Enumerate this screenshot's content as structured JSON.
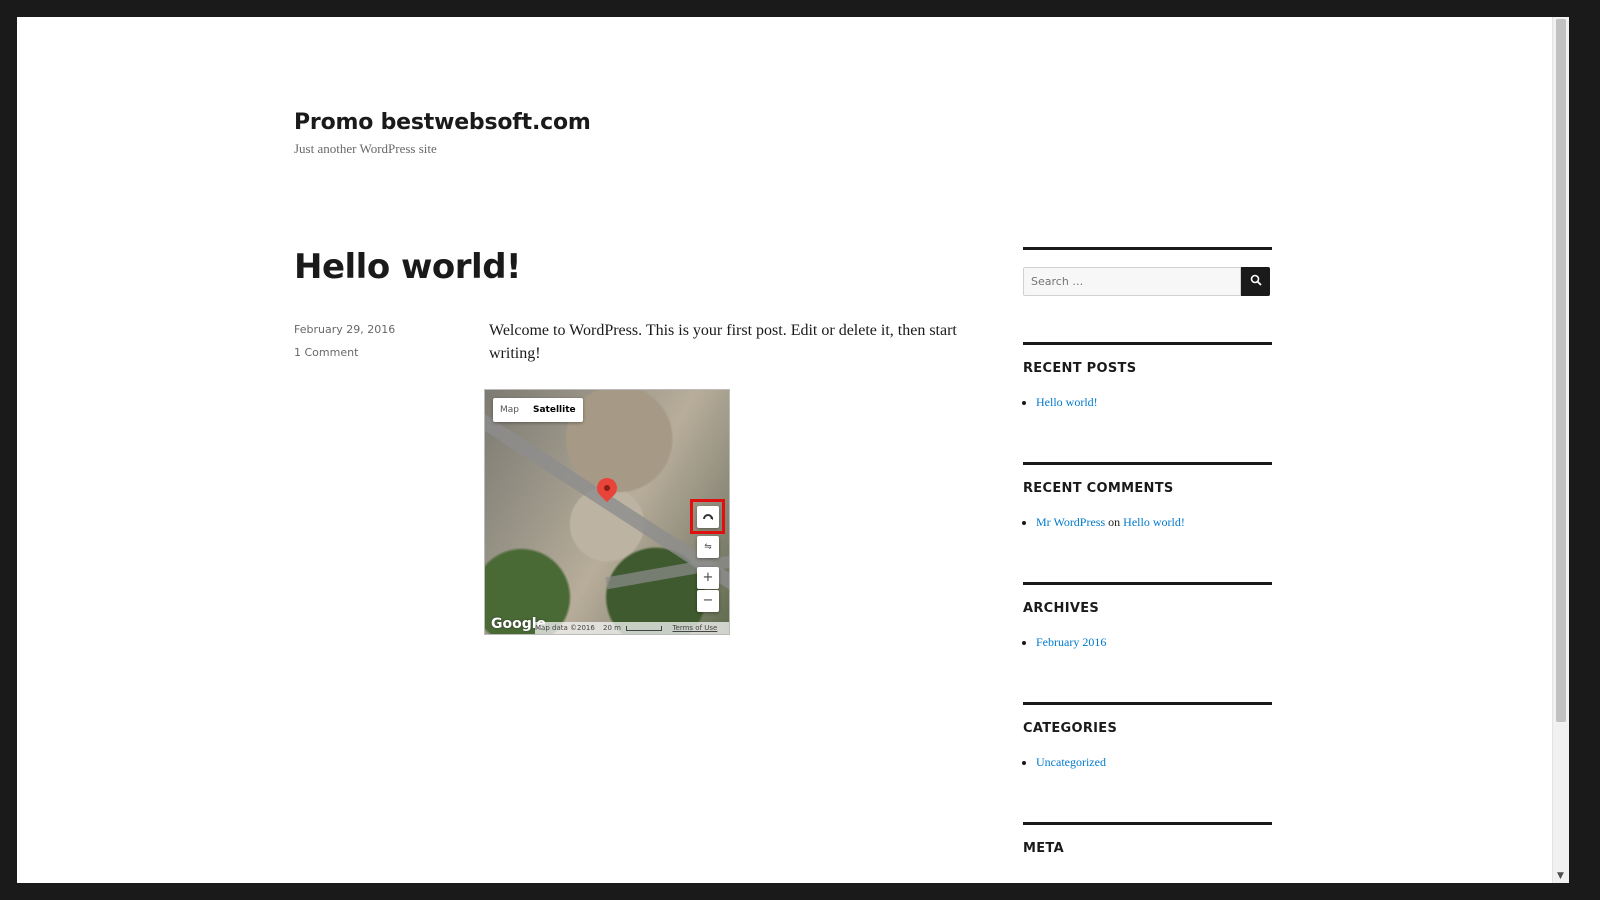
{
  "site": {
    "title": "Promo bestwebsoft.com",
    "description": "Just another WordPress site"
  },
  "post": {
    "title": "Hello world!",
    "date": "February 29, 2016",
    "comments": "1 Comment",
    "body": "Welcome to WordPress. This is your first post. Edit or delete it, then start writing!"
  },
  "map": {
    "type_map": "Map",
    "type_satellite": "Satellite",
    "selected_type": "Satellite",
    "logo": "Google",
    "attribution": "Map data ©2016",
    "scale": "20 m",
    "terms": "Terms of Use",
    "rotate_icon": "rotate-icon",
    "tilt_icon": "tilt-icon",
    "zoom_in": "+",
    "zoom_out": "−"
  },
  "sidebar": {
    "search_placeholder": "Search …",
    "search_icon": "search-icon",
    "recent_posts": {
      "title": "RECENT POSTS",
      "items": [
        "Hello world!"
      ]
    },
    "recent_comments": {
      "title": "RECENT COMMENTS",
      "author": "Mr WordPress",
      "connector": "on",
      "post": "Hello world!"
    },
    "archives": {
      "title": "ARCHIVES",
      "items": [
        "February 2016"
      ]
    },
    "categories": {
      "title": "CATEGORIES",
      "items": [
        "Uncategorized"
      ]
    },
    "meta": {
      "title": "META"
    }
  },
  "colors": {
    "link": "#007acc",
    "text": "#1a1a1a",
    "meta": "#686868",
    "highlight": "#e01010"
  }
}
